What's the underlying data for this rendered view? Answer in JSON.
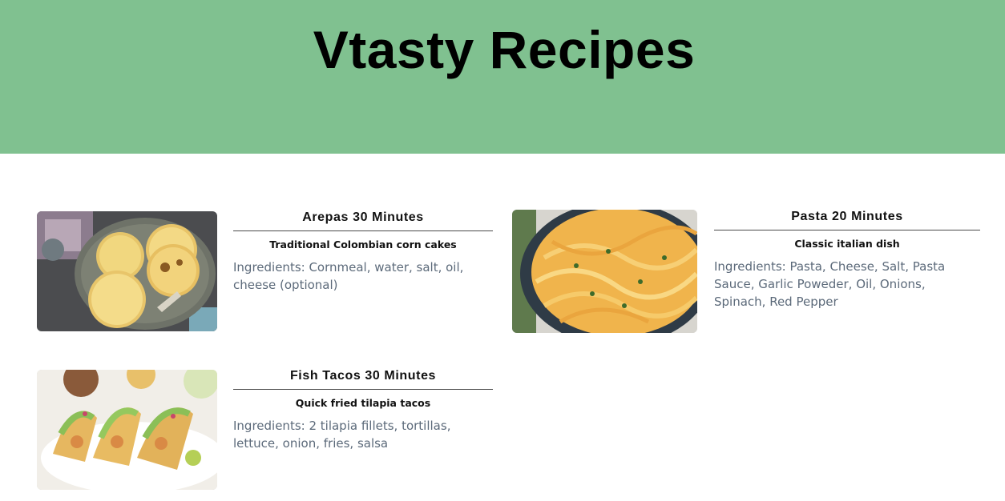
{
  "site": {
    "title": "Vtasty Recipes",
    "header_color": "#80c190"
  },
  "recipes": [
    {
      "title": "Arepas 30 Minutes",
      "subtitle": "Traditional Colombian corn cakes",
      "ingredients": "Ingredients: Cornmeal, water, salt, oil, cheese (optional)"
    },
    {
      "title": "Pasta 20 Minutes",
      "subtitle": "Classic italian dish",
      "ingredients": "Ingredients: Pasta, Cheese, Salt, Pasta Sauce, Garlic Poweder, Oil, Onions, Spinach, Red Pepper"
    },
    {
      "title": "Fish Tacos 30 Minutes",
      "subtitle": "Quick fried tilapia tacos",
      "ingredients": "Ingredients: 2 tilapia fillets, tortillas, lettuce, onion, fries, salsa"
    }
  ]
}
